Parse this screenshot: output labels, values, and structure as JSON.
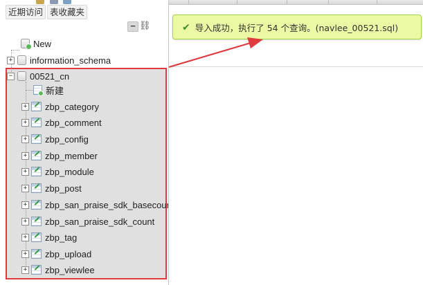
{
  "nav": {
    "recent_tabs": [
      {
        "label": "近期访问"
      },
      {
        "label": "表收藏夹"
      }
    ],
    "collapse_label": "−",
    "tree": {
      "databases": [
        {
          "name": "New",
          "is_new": true
        },
        {
          "name": "information_schema"
        },
        {
          "name": "00521_cn",
          "expanded": true,
          "new_table_label": "新建",
          "tables": [
            {
              "name": "zbp_category"
            },
            {
              "name": "zbp_comment"
            },
            {
              "name": "zbp_config"
            },
            {
              "name": "zbp_member"
            },
            {
              "name": "zbp_module"
            },
            {
              "name": "zbp_post"
            },
            {
              "name": "zbp_san_praise_sdk_basecount"
            },
            {
              "name": "zbp_san_praise_sdk_count"
            },
            {
              "name": "zbp_tag"
            },
            {
              "name": "zbp_upload"
            },
            {
              "name": "zbp_viewlee"
            }
          ]
        }
      ]
    }
  },
  "main": {
    "success_message": "导入成功，执行了 54 个查询。(navlee_00521.sql)"
  },
  "icons": {
    "success": "check-icon",
    "collapse": "collapse-icon",
    "link": "link-icon",
    "database": "database-icon",
    "table": "table-icon"
  },
  "colors": {
    "success_bg": "#ebf8a4",
    "success_border": "#a2d246",
    "highlight_border": "#e03a3e",
    "highlight_bg": "#e0e0e0",
    "annotation_arrow": "#e03a3e"
  }
}
